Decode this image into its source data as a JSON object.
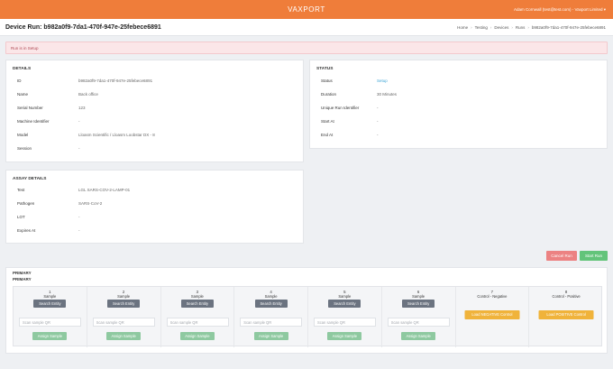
{
  "header": {
    "logo": "VAXPORT",
    "user": "Adam Cornwall (test@test.com) - Vaxport Limited ▾"
  },
  "subheader": {
    "title": "Device Run: b982a0f9-7da1-470f-947e-25febece6891",
    "breadcrumb": [
      "Home",
      "Testing",
      "Devices",
      "Runs",
      "b982a0f9-7da1-470f-947e-25febece6891"
    ]
  },
  "alert": "Run is in Setup",
  "details": {
    "title": "DETAILS",
    "rows": [
      {
        "key": "ID",
        "value": "b982a0f9-7da1-470f-947e-25febece6891"
      },
      {
        "key": "Name",
        "value": "Back office"
      },
      {
        "key": "Serial Number",
        "value": "123"
      },
      {
        "key": "Machine Identifier",
        "value": "-"
      },
      {
        "key": "Model",
        "value": "Lloasm Scientific / Lloasm Loobstar DX - 8"
      },
      {
        "key": "Session",
        "value": "-"
      }
    ]
  },
  "status": {
    "title": "STATUS",
    "rows": [
      {
        "key": "Status",
        "value": "Setup"
      },
      {
        "key": "Duration",
        "value": "30 Minutes"
      },
      {
        "key": "Unique Run Identifier",
        "value": "-"
      },
      {
        "key": "Start At",
        "value": "-"
      },
      {
        "key": "End At",
        "value": "-"
      }
    ]
  },
  "assay": {
    "title": "ASSAY DETAILS",
    "rows": [
      {
        "key": "Test",
        "value": "LGL SARS-COV-2-LAMP-01"
      },
      {
        "key": "Pathogen",
        "value": "SARS-CoV-2"
      },
      {
        "key": "LOT",
        "value": "-"
      },
      {
        "key": "Expires At",
        "value": "-"
      }
    ]
  },
  "actions": {
    "cancel": "Cancel Run",
    "start": "Start Run"
  },
  "primary": {
    "heading1": "PRIMARY",
    "heading2": "PRIMARY",
    "columns": [
      {
        "num": "1",
        "label": "Sample",
        "search": "Search Entity",
        "placeholder": "Scan sample QR",
        "assign": "Assign Sample"
      },
      {
        "num": "2",
        "label": "Sample",
        "search": "Search Entity",
        "placeholder": "Scan sample QR",
        "assign": "Assign Sample"
      },
      {
        "num": "3",
        "label": "Sample",
        "search": "Search Entity",
        "placeholder": "Scan sample QR",
        "assign": "Assign Sample"
      },
      {
        "num": "4",
        "label": "Sample",
        "search": "Search Entity",
        "placeholder": "Scan sample QR",
        "assign": "Assign Sample"
      },
      {
        "num": "5",
        "label": "Sample",
        "search": "Search Entity",
        "placeholder": "Scan sample QR",
        "assign": "Assign Sample"
      },
      {
        "num": "6",
        "label": "Sample",
        "search": "Search Entity",
        "placeholder": "Scan sample QR",
        "assign": "Assign Sample"
      },
      {
        "num": "7",
        "label": "Control - Negative",
        "control": "Load NEGATIVE Control"
      },
      {
        "num": "8",
        "label": "Control - Positive",
        "control": "Load POSITIVE Control"
      }
    ]
  }
}
